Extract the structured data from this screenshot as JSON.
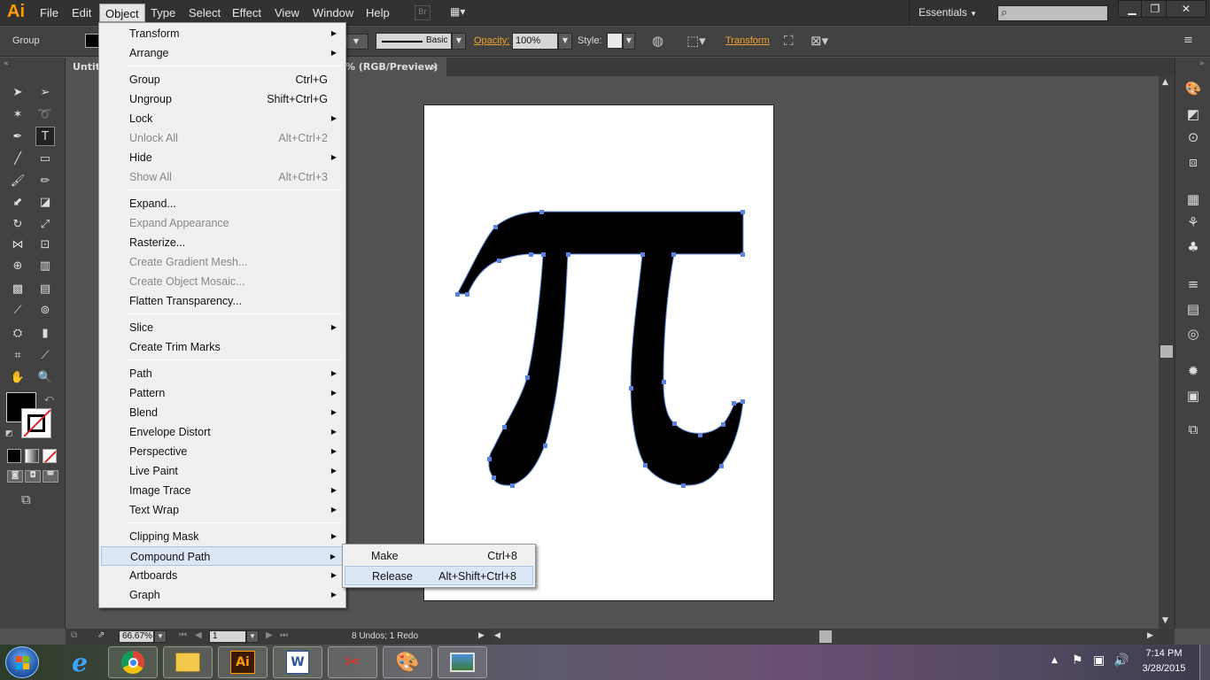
{
  "app": {
    "logo_text": "Ai",
    "brand_color": "#ff9a00"
  },
  "menubar": {
    "items": [
      "File",
      "Edit",
      "Object",
      "Type",
      "Select",
      "Effect",
      "View",
      "Window",
      "Help"
    ],
    "active": "Object",
    "br_label": "Br",
    "workspace": "Essentials"
  },
  "controlbar": {
    "selection_type": "Group",
    "stroke_style": "Basic",
    "opacity_label": "Opacity:",
    "opacity_value": "100%",
    "style_label": "Style:",
    "transform_label": "Transform"
  },
  "document_tab": {
    "title_fragment": "Untitl",
    "title_suffix": "% (RGB/Preview)",
    "close_glyph": "×"
  },
  "object_menu": {
    "groups": [
      [
        {
          "label": "Transform",
          "submenu": true
        },
        {
          "label": "Arrange",
          "submenu": true
        }
      ],
      [
        {
          "label": "Group",
          "shortcut": "Ctrl+G"
        },
        {
          "label": "Ungroup",
          "shortcut": "Shift+Ctrl+G"
        },
        {
          "label": "Lock",
          "submenu": true
        },
        {
          "label": "Unlock All",
          "shortcut": "Alt+Ctrl+2",
          "disabled": true
        },
        {
          "label": "Hide",
          "submenu": true
        },
        {
          "label": "Show All",
          "shortcut": "Alt+Ctrl+3",
          "disabled": true
        }
      ],
      [
        {
          "label": "Expand..."
        },
        {
          "label": "Expand Appearance",
          "disabled": true
        },
        {
          "label": "Rasterize..."
        },
        {
          "label": "Create Gradient Mesh...",
          "disabled": true
        },
        {
          "label": "Create Object Mosaic...",
          "disabled": true
        },
        {
          "label": "Flatten Transparency..."
        }
      ],
      [
        {
          "label": "Slice",
          "submenu": true
        },
        {
          "label": "Create Trim Marks"
        }
      ],
      [
        {
          "label": "Path",
          "submenu": true
        },
        {
          "label": "Pattern",
          "submenu": true
        },
        {
          "label": "Blend",
          "submenu": true
        },
        {
          "label": "Envelope Distort",
          "submenu": true
        },
        {
          "label": "Perspective",
          "submenu": true
        },
        {
          "label": "Live Paint",
          "submenu": true
        },
        {
          "label": "Image Trace",
          "submenu": true
        },
        {
          "label": "Text Wrap",
          "submenu": true
        }
      ],
      [
        {
          "label": "Clipping Mask",
          "submenu": true
        },
        {
          "label": "Compound Path",
          "submenu": true,
          "highlighted": true
        },
        {
          "label": "Artboards",
          "submenu": true
        },
        {
          "label": "Graph",
          "submenu": true
        }
      ]
    ]
  },
  "compound_path_submenu": {
    "items": [
      {
        "label": "Make",
        "shortcut": "Ctrl+8"
      },
      {
        "label": "Release",
        "shortcut": "Alt+Shift+Ctrl+8",
        "highlighted": true
      }
    ]
  },
  "statusbar": {
    "zoom": "66.67%",
    "artboard_number": "1",
    "undo_status": "8 Undos; 1 Redo"
  },
  "taskbar": {
    "time": "7:14 PM",
    "date": "3/28/2015",
    "apps": [
      "start-orb",
      "internet-explorer",
      "chrome",
      "file-explorer",
      "illustrator",
      "word",
      "snipping-tool",
      "paint",
      "photo-viewer"
    ],
    "illustrator_label": "Ai",
    "word_label": "W"
  },
  "icons": {
    "submenu_arrow": "▶",
    "search": "⌕"
  }
}
